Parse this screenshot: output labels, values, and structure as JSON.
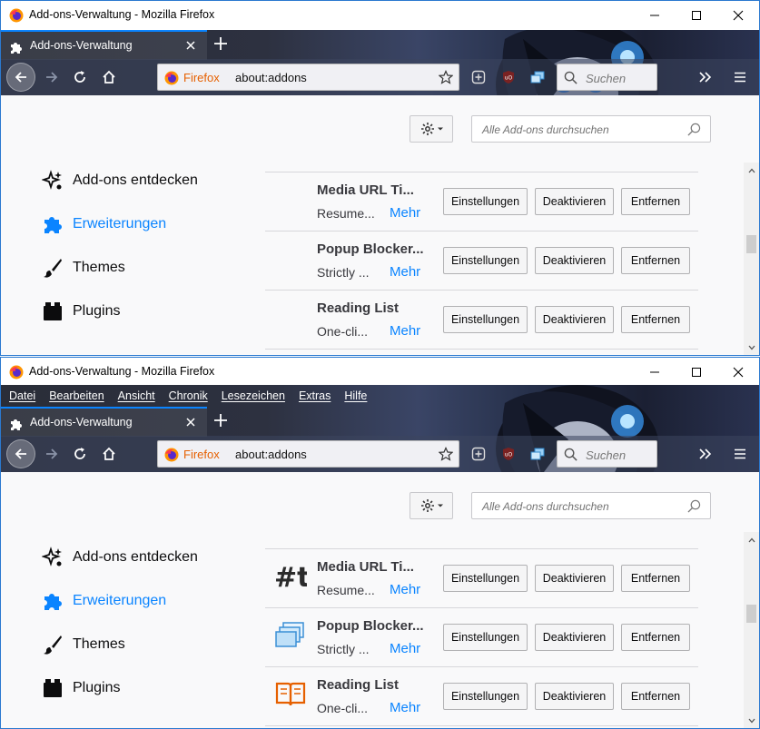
{
  "windows": [
    {
      "window_title": "Add-ons-Verwaltung - Mozilla Firefox",
      "menu_visible": false,
      "tab": {
        "label": "Add-ons-Verwaltung"
      },
      "urlbar": {
        "identity_label": "Firefox",
        "url": "about:addons"
      },
      "search": {
        "placeholder": "Suchen"
      },
      "addon_search": {
        "placeholder": "Alle Add-ons durchsuchen"
      },
      "categories": [
        {
          "label": "Add-ons entdecken",
          "icon": "discover-icon"
        },
        {
          "label": "Erweiterungen",
          "icon": "puzzle-icon",
          "active": true
        },
        {
          "label": "Themes",
          "icon": "brush-icon"
        },
        {
          "label": "Plugins",
          "icon": "plugin-icon"
        }
      ],
      "addons": [
        {
          "name": "Media URL Ti...",
          "desc": "Resume...",
          "more": "Mehr",
          "icon": "none"
        },
        {
          "name": "Popup Blocker...",
          "desc": "Strictly ...",
          "more": "Mehr",
          "icon": "none"
        },
        {
          "name": "Reading List",
          "desc": "One-cli...",
          "more": "Mehr",
          "icon": "none"
        }
      ]
    },
    {
      "window_title": "Add-ons-Verwaltung - Mozilla Firefox",
      "menu_visible": true,
      "menu": [
        "Datei",
        "Bearbeiten",
        "Ansicht",
        "Chronik",
        "Lesezeichen",
        "Extras",
        "Hilfe"
      ],
      "tab": {
        "label": "Add-ons-Verwaltung"
      },
      "urlbar": {
        "identity_label": "Firefox",
        "url": "about:addons"
      },
      "search": {
        "placeholder": "Suchen"
      },
      "addon_search": {
        "placeholder": "Alle Add-ons durchsuchen"
      },
      "categories": [
        {
          "label": "Add-ons entdecken",
          "icon": "discover-icon"
        },
        {
          "label": "Erweiterungen",
          "icon": "puzzle-icon",
          "active": true
        },
        {
          "label": "Themes",
          "icon": "brush-icon"
        },
        {
          "label": "Plugins",
          "icon": "plugin-icon"
        }
      ],
      "addons": [
        {
          "name": "Media URL Ti...",
          "desc": "Resume...",
          "more": "Mehr",
          "icon": "hashtag-t-icon"
        },
        {
          "name": "Popup Blocker...",
          "desc": "Strictly ...",
          "more": "Mehr",
          "icon": "stacked-windows-icon"
        },
        {
          "name": "Reading List",
          "desc": "One-cli...",
          "more": "Mehr",
          "icon": "open-book-icon"
        }
      ]
    }
  ],
  "buttons": {
    "settings": "Einstellungen",
    "disable": "Deaktivieren",
    "remove": "Entfernen"
  },
  "colors": {
    "accent": "#0a84ff",
    "firefox_orange": "#e66000",
    "window_border": "#2b79d0"
  }
}
